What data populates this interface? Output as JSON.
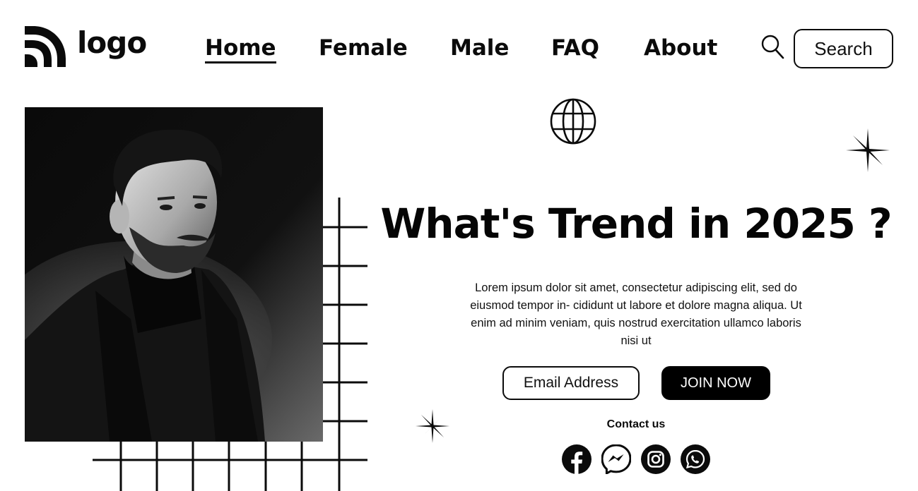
{
  "header": {
    "logo_text": "logo",
    "nav": [
      {
        "label": "Home",
        "active": true
      },
      {
        "label": "Female",
        "active": false
      },
      {
        "label": "Male",
        "active": false
      },
      {
        "label": "FAQ",
        "active": false
      },
      {
        "label": "About",
        "active": false
      }
    ],
    "search_icon": "search-icon",
    "search_button_label": "Search"
  },
  "hero": {
    "title": "What's Trend in 2025 ?",
    "description": "Lorem ipsum dolor sit amet, consectetur adipiscing elit, sed do eiusmod tempor in- cididunt ut labore et dolore magna aliqua. Ut enim ad minim veniam, quis nostrud exercitation ullamco laboris nisi ut",
    "email_placeholder": "Email Address",
    "join_button_label": "JOIN NOW"
  },
  "contact": {
    "label": "Contact us",
    "socials": [
      "facebook-icon",
      "messenger-icon",
      "instagram-icon",
      "whatsapp-icon"
    ]
  },
  "decor": {
    "globe_icon": "globe-icon",
    "sparkle_icon": "sparkle-icon"
  },
  "colors": {
    "text": "#0b0b0b",
    "background": "#ffffff",
    "button_bg": "#000000",
    "button_text": "#ffffff"
  }
}
